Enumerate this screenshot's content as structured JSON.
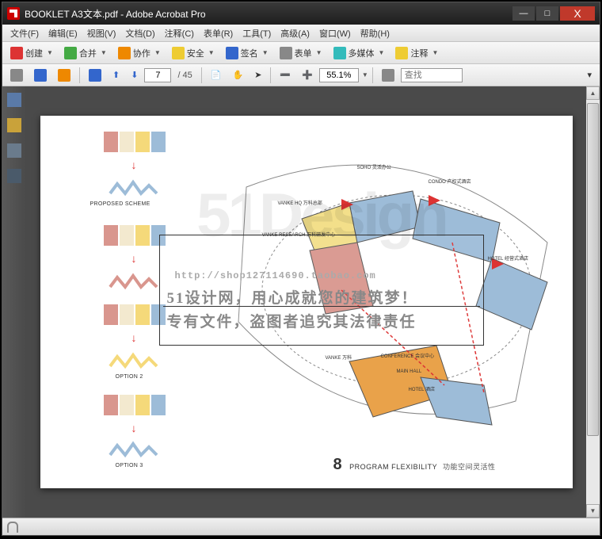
{
  "window": {
    "title": "BOOKLET A3文本.pdf - Adobe Acrobat Pro",
    "min": "—",
    "max": "□",
    "close": "X"
  },
  "menubar": [
    "文件(F)",
    "编辑(E)",
    "视图(V)",
    "文档(D)",
    "注释(C)",
    "表单(R)",
    "工具(T)",
    "高级(A)",
    "窗口(W)",
    "帮助(H)"
  ],
  "toolbar1": {
    "create": "创建",
    "combine": "合并",
    "collab": "协作",
    "secure": "安全",
    "sign": "签名",
    "forms": "表单",
    "multimedia": "多媒体",
    "comment": "注释"
  },
  "toolbar2": {
    "page_current": "7",
    "page_total": "/ 45",
    "zoom": "55.1%",
    "find_placeholder": "查找"
  },
  "document": {
    "scheme_labels": [
      "PROPOSED SCHEME",
      "OPTION 2",
      "OPTION 3"
    ],
    "annotations": {
      "soho": "SOHO 灵活办公",
      "condo": "CONDO 产权式酒店",
      "hotel": "HOTEL 经营式酒店",
      "vanke_hq": "VANKE HQ 万科总部",
      "vanke_research": "VANKE RESEARCH 万科研发中心",
      "vanke": "VANKE 万科",
      "conference": "CONFERENCE 会议中心",
      "main_hall": "MAIN HALL",
      "hotel2": "HOTEL 酒店"
    },
    "watermark": {
      "big": "51Design",
      "url": "http://shop127114690.taobao.com",
      "line1": "51设计网，用心成就您的建筑梦！",
      "line2": "专有文件，盗图者追究其法律责任"
    },
    "footer": {
      "num": "8",
      "title_en": "PROGRAM FLEXIBILITY",
      "title_cn": "功能空间灵活性"
    }
  }
}
